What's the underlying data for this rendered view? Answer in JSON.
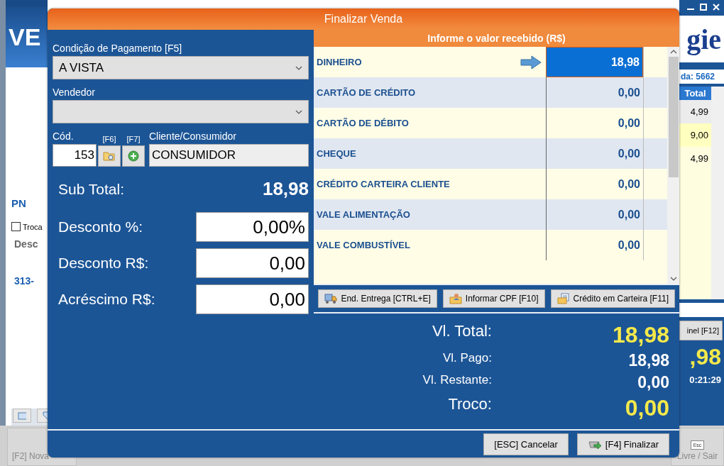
{
  "background_window": {
    "title": "VE",
    "logo": "gie",
    "sale_label": "da: 5662",
    "table": {
      "columns": [
        "Total"
      ],
      "rows": [
        {
          "total": "4,99"
        },
        {
          "total": "9,00"
        },
        {
          "total": "4,99"
        }
      ]
    },
    "search_label": "PN",
    "exchange": {
      "label": "Troca",
      "checked": false
    },
    "column_label": "Desc",
    "product_code": "313-",
    "panel_button": "inel [F12]",
    "total": ",98",
    "time": "0:21:29",
    "new_sale_button": "[F2] Nova",
    "exit_button": "Livre / Sair",
    "esc_key": "Esc"
  },
  "dialog": {
    "title": "Finalizar Venda",
    "payment_condition": {
      "label": "Condição de Pagamento [F5]",
      "value": "A VISTA"
    },
    "seller": {
      "label": "Vendedor"
    },
    "customer": {
      "code_label": "Cód.",
      "code": "153",
      "search_hotkey": "[F6]",
      "add_hotkey": "[F7]",
      "label": "Cliente/Consumidor",
      "value": "CONSUMIDOR"
    },
    "subtotal": {
      "label": "Sub Total:",
      "value": "18,98"
    },
    "adjustments": [
      {
        "label": "Desconto %:",
        "value": "0,00%"
      },
      {
        "label": "Desconto R$:",
        "value": "0,00"
      },
      {
        "label": "Acréscimo R$:",
        "value": "0,00"
      }
    ],
    "payments_header": "Informe o valor recebido (R$)",
    "payments": [
      {
        "name": "DINHEIRO",
        "value": "18,98",
        "selected": true
      },
      {
        "name": "CARTÃO DE CRÉDITO",
        "value": "0,00",
        "selected": false
      },
      {
        "name": "CARTÃO DE DÉBITO",
        "value": "0,00",
        "selected": false
      },
      {
        "name": "CHEQUE",
        "value": "0,00",
        "selected": false
      },
      {
        "name": "CRÉDITO CARTEIRA CLIENTE",
        "value": "0,00",
        "selected": false
      },
      {
        "name": "VALE ALIMENTAÇÃO",
        "value": "0,00",
        "selected": false
      },
      {
        "name": "VALE COMBUSTÍVEL",
        "value": "0,00",
        "selected": false
      }
    ],
    "actions": [
      {
        "label": "End. Entrega [CTRL+E]",
        "kind": "delivery"
      },
      {
        "label": "Informar CPF [F10]",
        "kind": "person"
      },
      {
        "label": "Crédito em Carteira [F11]",
        "kind": "wallet"
      }
    ],
    "totals": [
      {
        "label": "Vl. Total:",
        "value": "18,98",
        "kind": "major"
      },
      {
        "label": "Vl. Pago:",
        "value": "18,98",
        "kind": "minor"
      },
      {
        "label": "Vl. Restante:",
        "value": "0,00",
        "kind": "minor"
      },
      {
        "label": "Troco:",
        "value": "0,00",
        "kind": "major"
      }
    ],
    "buttons": [
      {
        "label": "[ESC] Cancelar",
        "kind": "cancel"
      },
      {
        "label": "[F4] Finalizar",
        "kind": "confirm"
      }
    ]
  }
}
